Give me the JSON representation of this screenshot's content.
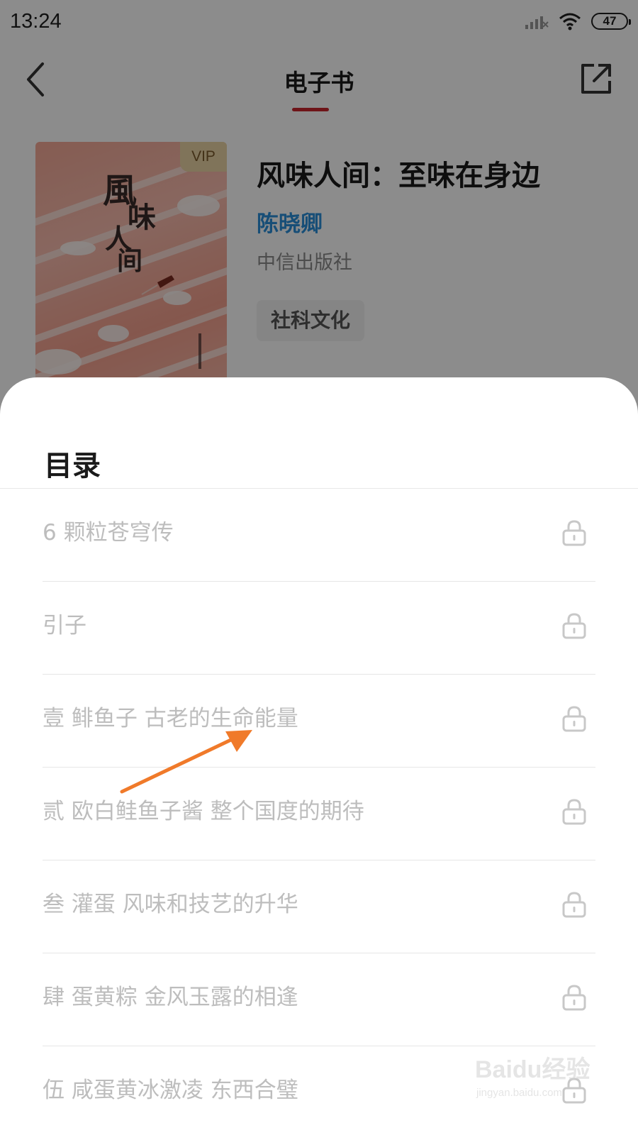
{
  "status_bar": {
    "time": "13:24",
    "battery": "47"
  },
  "nav": {
    "title": "电子书"
  },
  "book": {
    "vip_label": "VIP",
    "title": "风味人间：至味在身边",
    "author": "陈晓卿",
    "publisher": "中信出版社",
    "tag": "社科文化"
  },
  "toc": {
    "title": "目录",
    "items": [
      {
        "label": "6 颗粒苍穹传",
        "locked": true
      },
      {
        "label": "引子",
        "locked": true
      },
      {
        "label": "壹 鲱鱼子 古老的生命能量",
        "locked": true
      },
      {
        "label": "贰 欧白鲑鱼子酱 整个国度的期待",
        "locked": true
      },
      {
        "label": "叁 灌蛋 风味和技艺的升华",
        "locked": true
      },
      {
        "label": "肆 蛋黄粽 金风玉露的相逢",
        "locked": true
      },
      {
        "label": "伍 咸蛋黄冰激凌 东西合璧",
        "locked": true
      }
    ]
  },
  "watermark": {
    "logo": "Baidu经验",
    "sub": "jingyan.baidu.com"
  },
  "colors": {
    "accent": "#c8262c",
    "author": "#2a8fd9",
    "arrow": "#f07a2a"
  }
}
